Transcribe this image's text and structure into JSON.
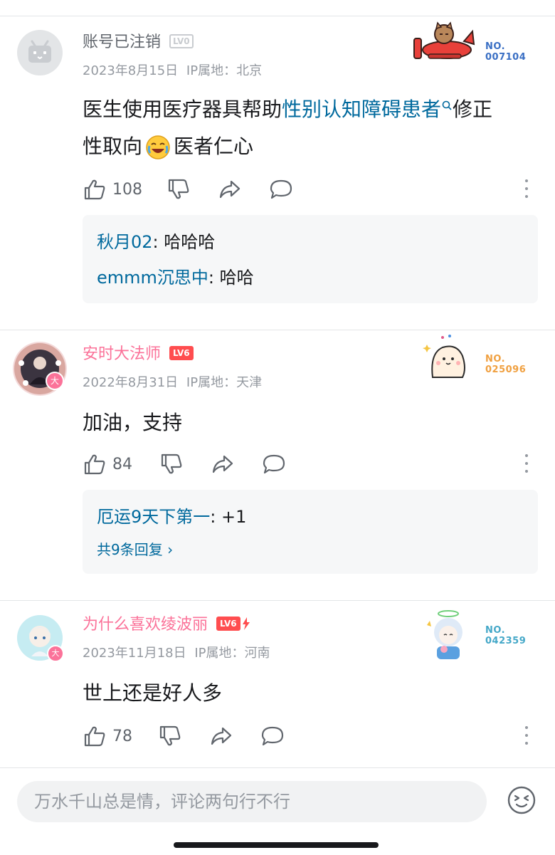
{
  "comments": [
    {
      "username": "账号已注销",
      "level": "LV0",
      "date": "2023年8月15日",
      "ip": "IP属地：北京",
      "text_pre": "医生使用医疗器具帮助",
      "text_link": "性别认知障碍患者",
      "text_mid1": "修正",
      "text_mid2": "性取向",
      "text_post": "医者仁心",
      "likes": "108",
      "badge_no_label": "NO.",
      "badge_no_value": "007104",
      "replies": [
        {
          "name": "秋月02",
          "sep": ": ",
          "text": "哈哈哈"
        },
        {
          "name": "emmm沉思中",
          "sep": ": ",
          "text": "哈哈"
        }
      ]
    },
    {
      "username": "安时大法师",
      "level": "LV6",
      "date": "2022年8月31日",
      "ip": "IP属地：天津",
      "text": "加油，支持",
      "likes": "84",
      "badge_no_label": "NO.",
      "badge_no_value": "025096",
      "avatar_tag": "大",
      "replies": [
        {
          "name": "厄运9天下第一",
          "sep": ": ",
          "text": "+1"
        }
      ],
      "more_replies": "共9条回复 ›"
    },
    {
      "username": "为什么喜欢绫波丽",
      "level": "LV6",
      "date": "2023年11月18日",
      "ip": "IP属地：河南",
      "text": "世上还是好人多",
      "likes": "78",
      "badge_no_label": "NO.",
      "badge_no_value": "042359",
      "avatar_tag": "大"
    }
  ],
  "input": {
    "placeholder": "万水千山总是情，评论两句行不行"
  },
  "colors": {
    "link": "#00699d",
    "vip_name": "#fb7299",
    "level6": "#ff4d4f",
    "meta": "#9499a0"
  },
  "icons": [
    "like-icon",
    "dislike-icon",
    "share-icon",
    "reply-icon",
    "more-icon",
    "emoji-icon"
  ]
}
